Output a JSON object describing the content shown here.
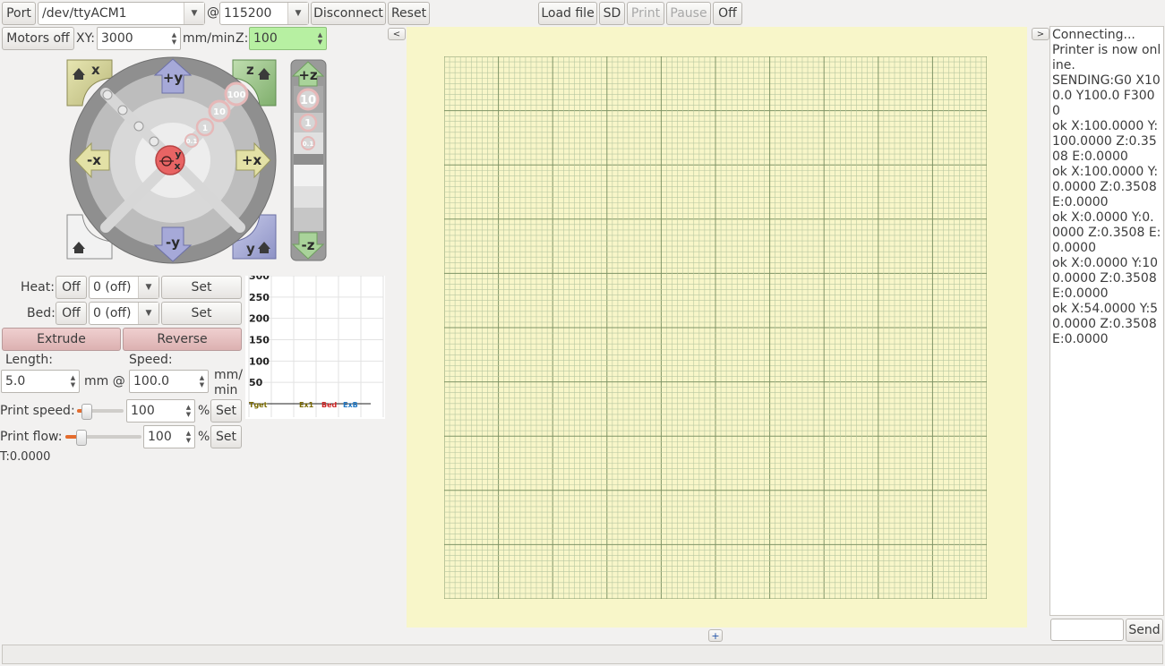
{
  "toolbar": {
    "port_label": "Port",
    "port_value": "/dev/ttyACM1",
    "at": "@",
    "baud_value": "115200",
    "disconnect_label": "Disconnect",
    "reset_label": "Reset",
    "load_file_label": "Load file",
    "sd_label": "SD",
    "print_label": "Print",
    "pause_label": "Pause",
    "off_label": "Off"
  },
  "motion": {
    "motors_off_label": "Motors off",
    "xy_label": "XY:",
    "xy_value": "3000",
    "unit_label": "mm/min",
    "z_label": "Z:",
    "z_value": "100"
  },
  "jog": {
    "home_x": "x",
    "home_z": "z",
    "home_y": "y",
    "plus_y": "+y",
    "minus_y": "-y",
    "minus_x": "-x",
    "plus_x": "+x",
    "step_100": "100",
    "step_10": "10",
    "step_1": "1",
    "step_01": "0.1",
    "center_y": "y",
    "center_x": "x",
    "plus_z": "+z",
    "minus_z": "-z",
    "z_10": "10",
    "z_1": "1",
    "z_01": "0.1"
  },
  "temps": {
    "heat_label": "Heat:",
    "heat_off": "Off",
    "heat_value": "0 (off)",
    "heat_set": "Set",
    "bed_label": "Bed:",
    "bed_off": "Off",
    "bed_value": "0 (off)",
    "bed_set": "Set"
  },
  "extrude": {
    "extrude_label": "Extrude",
    "reverse_label": "Reverse",
    "length_label": "Length:",
    "speed_label": "Speed:",
    "length_value": "5.0",
    "mm_at": "mm @",
    "speed_value": "100.0",
    "mm_unit": "mm/",
    "min_unit": "min"
  },
  "speeds": {
    "print_speed_label": "Print speed:",
    "print_speed_value": "100",
    "print_speed_fraction": 0.2,
    "pct1": "%",
    "set1": "Set",
    "print_flow_label": "Print flow:",
    "print_flow_value": "100",
    "print_flow_fraction": 0.2,
    "pct2": "%",
    "set2": "Set",
    "t_readout": "T:0.0000"
  },
  "graph": {
    "ticks": [
      "300",
      "250",
      "200",
      "150",
      "100",
      "50"
    ],
    "legend_target": "Tget",
    "legend_ex1": "Ex1",
    "legend_bed": "Bed",
    "legend_exb": "ExB",
    "colors": {
      "ex1": "#7a6a00",
      "bed": "#cc2222",
      "exb": "#1f77c4"
    }
  },
  "plater": {
    "collapse_label": "<",
    "expand_label": ">",
    "add_label": "+"
  },
  "console": {
    "lines": [
      "Connecting...",
      "Printer is now online.",
      "SENDING:G0 X100.0 Y100.0 F3000",
      "ok X:100.0000 Y:100.0000 Z:0.3508 E:0.0000",
      "ok X:100.0000 Y:0.0000 Z:0.3508 E:0.0000",
      "ok X:0.0000 Y:0.0000 Z:0.3508 E:0.0000",
      "ok X:0.0000 Y:100.0000 Z:0.3508 E:0.0000",
      "ok X:54.0000 Y:50.0000 Z:0.3508 E:0.0000"
    ],
    "command_value": "",
    "send_label": "Send"
  },
  "colors": {
    "plate_bg": "#f8f6c9",
    "grid_minor": "#b7c7a0",
    "grid_major": "#7f9466",
    "accent_orange": "#e46c2d",
    "z_field_bg": "#b7f0a2"
  }
}
